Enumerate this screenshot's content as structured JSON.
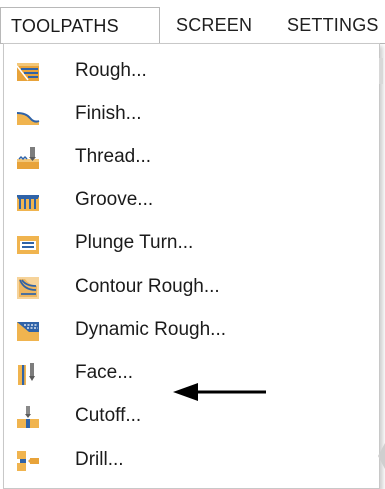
{
  "ribbon": {
    "tabs": [
      {
        "label": "TOOLPATHS",
        "active": true
      },
      {
        "label": "SCREEN",
        "active": false
      },
      {
        "label": "SETTINGS",
        "active": false
      }
    ]
  },
  "menu": {
    "items": [
      {
        "label": "Rough...",
        "icon": "rough-toolpath-icon"
      },
      {
        "label": "Finish...",
        "icon": "finish-toolpath-icon"
      },
      {
        "label": "Thread...",
        "icon": "thread-toolpath-icon"
      },
      {
        "label": "Groove...",
        "icon": "groove-toolpath-icon"
      },
      {
        "label": "Plunge Turn...",
        "icon": "plunge-turn-icon"
      },
      {
        "label": "Contour Rough...",
        "icon": "contour-rough-icon"
      },
      {
        "label": "Dynamic Rough...",
        "icon": "dynamic-rough-icon"
      },
      {
        "label": "Face...",
        "icon": "face-toolpath-icon"
      },
      {
        "label": "Cutoff...",
        "icon": "cutoff-toolpath-icon",
        "highlighted_by_arrow": true
      },
      {
        "label": "Drill...",
        "icon": "drill-toolpath-icon"
      }
    ]
  },
  "annotation": {
    "arrow_icon": "left-arrow-icon",
    "color": "#000000"
  },
  "colors": {
    "icon_orange": "#e8a33a",
    "icon_blue": "#2f63a8",
    "icon_gray": "#8a8a8a",
    "tab_border": "#b8b8b8"
  }
}
